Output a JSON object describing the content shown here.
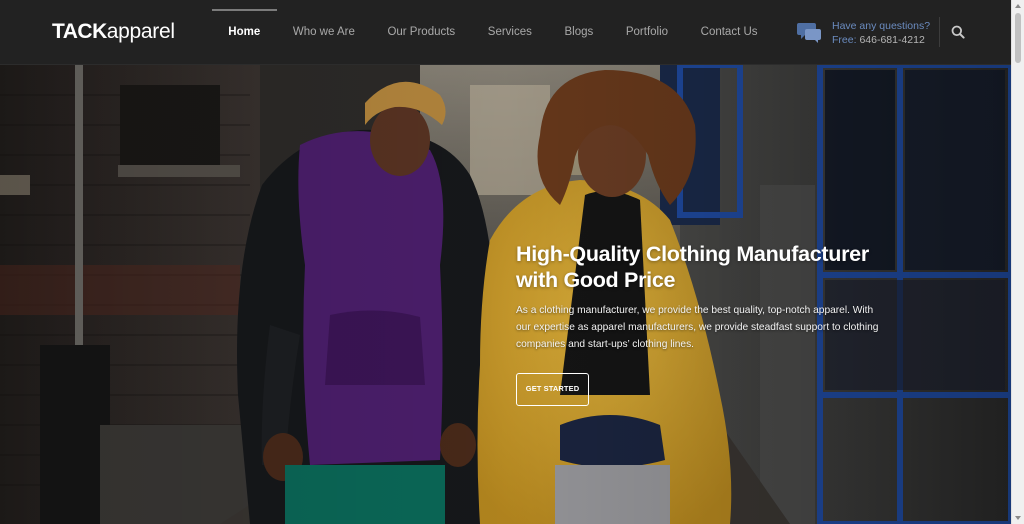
{
  "brand": {
    "logo_bold": "TACK",
    "logo_light": "apparel"
  },
  "nav": {
    "items": [
      {
        "label": "Home",
        "active": true
      },
      {
        "label": "Who we Are",
        "active": false
      },
      {
        "label": "Our Products",
        "active": false
      },
      {
        "label": "Services",
        "active": false
      },
      {
        "label": "Blogs",
        "active": false
      },
      {
        "label": "Portfolio",
        "active": false
      },
      {
        "label": "Contact Us",
        "active": false
      }
    ]
  },
  "contact": {
    "question": "Have any questions?",
    "phone_prefix": "Free:",
    "phone": "646-681-4212",
    "icon": "chat-bubbles-icon"
  },
  "search": {
    "icon": "search-icon"
  },
  "hero": {
    "title": "High-Quality Clothing Manufacturer with Good Price",
    "description": "As a clothing manufacturer, we provide the best quality, top-notch apparel. With our expertise as apparel manufacturers, we provide steadfast support to clothing companies and start-ups’ clothing lines.",
    "cta_label": "GET STARTED",
    "image": "two-models-in-alley-photo"
  },
  "colors": {
    "header_bg": "#222222",
    "accent_blue": "#6b8cc0",
    "hero_text": "#ffffff"
  }
}
